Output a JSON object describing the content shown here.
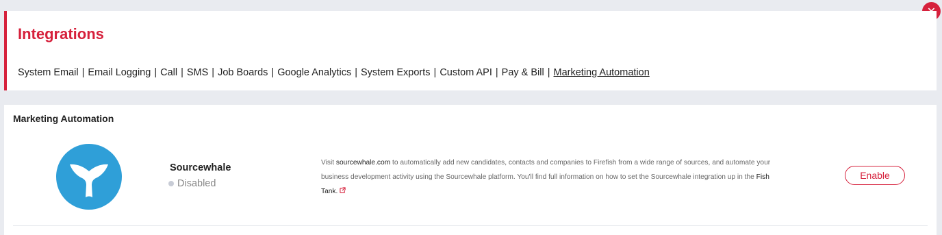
{
  "header": {
    "title": "Integrations",
    "nav": [
      {
        "label": "System Email",
        "active": false
      },
      {
        "label": "Email Logging",
        "active": false
      },
      {
        "label": "Call",
        "active": false
      },
      {
        "label": "SMS",
        "active": false
      },
      {
        "label": "Job Boards",
        "active": false
      },
      {
        "label": "Google Analytics",
        "active": false
      },
      {
        "label": "System Exports",
        "active": false
      },
      {
        "label": "Custom API",
        "active": false
      },
      {
        "label": "Pay & Bill",
        "active": false
      },
      {
        "label": "Marketing Automation",
        "active": true
      }
    ],
    "separator": "|"
  },
  "close": {
    "icon": "close-icon",
    "glyph": "✕"
  },
  "section": {
    "title": "Marketing Automation",
    "integration": {
      "name": "Sourcewhale",
      "status": "Disabled",
      "logo_icon": "sourcewhale-logo-icon",
      "logo_color": "#2f9fd8",
      "description": {
        "pre": "Visit ",
        "link": "sourcewhale.com",
        "mid": " to automatically add new candidates, contacts and companies to Firefish from a wide range of sources, and automate your business development activity using the Sourcewhale platform. You'll find full information on how to set the Sourcewhale integration up in the ",
        "link2": "Fish Tank.",
        "ext_icon": "external-link-icon"
      },
      "action_label": "Enable"
    }
  },
  "colors": {
    "accent": "#d6213c",
    "background": "#e9ebf0",
    "panel": "#ffffff"
  }
}
